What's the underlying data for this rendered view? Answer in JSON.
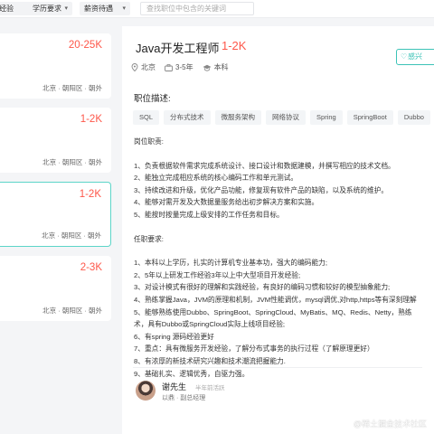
{
  "filters": [
    {
      "label": "经验"
    },
    {
      "label": "学历要求"
    },
    {
      "label": "薪资待遇"
    }
  ],
  "search": {
    "placeholder": "查找职位中包含的关键词"
  },
  "job_list": [
    {
      "salary": "20-25K",
      "location": "北京 · 朝阳区 · 朝外"
    },
    {
      "salary": "1-2K",
      "location": "北京 · 朝阳区 · 朝外"
    },
    {
      "salary": "1-2K",
      "location": "北京 · 朝阳区 · 朝外"
    },
    {
      "salary": "2-3K",
      "location": "北京 · 朝阳区 · 朝外"
    }
  ],
  "detail": {
    "title": "Java开发工程师",
    "salary": "1-2K",
    "city": "北京",
    "experience": "3-5年",
    "education": "本科",
    "interest_label": "感兴",
    "section_title": "职位描述:",
    "tags": [
      "SQL",
      "分布式技术",
      "微服务架构",
      "网络协议",
      "Spring",
      "SpringBoot",
      "Dubbo"
    ],
    "description": [
      "岗位职责:",
      "",
      "1、负责根据软件需求完成系统设计、接口设计和数据建模，并撰写相应的技术文档。",
      "2、能独立完成相应系统的核心编码工作和单元测试。",
      "3、持续改进和升级，优化产品功能，修复现有软件产品的缺陷，以及系统的维护。",
      "4、能够对需开发及大数据量服务给出初步解决方案和实施。",
      "5、能按时按量完成上级安排的工作任务和目标。",
      "",
      "任职要求:",
      "",
      "1、本科以上学历，扎实的计算机专业基本功，强大的编码能力;",
      "2、5年以上研发工作经验3年以上中大型项目开发经验;",
      "3、对设计模式有很好的理解和实践经验，有良好的编码习惯和较好的模型抽象能力;",
      "4、熟练掌握Java，JVM的原理和机制，JVM性能调优，mysql调优,对http,https等有深刻理解",
      "5、能够熟练使用Dubbo、SpringBoot、SpringCloud、MyBatis、MQ、Redis、Netty，熟练",
      "术，具有Dubbo或SpringCloud实际上线项目经验;",
      "6、有spring 源码经验更好",
      "7、重点：具有微服务开发经验，了解分布式事务的执行过程（了解原理更好）",
      "8、有浓厚的新技术研究兴趣和技术潮流把握能力.",
      "9、基础扎实、逻辑优秀，自驱力强。"
    ],
    "recruiter": {
      "name": "谢先生",
      "status": "半年前活跃",
      "title": "以鼎 · 副总经理"
    }
  },
  "watermark": "@稀土掘金技术社区",
  "colors": {
    "salary": "#fe574a",
    "accent": "#3cc3b7",
    "active_border": "#5dd5c8"
  }
}
